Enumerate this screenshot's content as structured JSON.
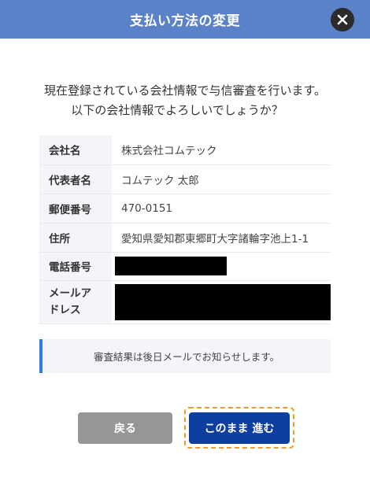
{
  "header": {
    "title": "支払い方法の変更",
    "close_icon": "close-icon"
  },
  "message": {
    "line1": "現在登録されている会社情報で与信審査を行います。",
    "line2": "以下の会社情報でよろしいでしょうか？"
  },
  "company_info": {
    "rows": [
      {
        "label": "会社名",
        "value": "株式会社コムテック"
      },
      {
        "label": "代表者名",
        "value": "コムテック 太郎"
      },
      {
        "label": "郵便番号",
        "value": "470-0151"
      },
      {
        "label": "住所",
        "value": "愛知県愛知郡東郷町大字諸輪字池上1-1"
      },
      {
        "label": "電話番号",
        "value": null,
        "redacted": true
      },
      {
        "label": "メールアドレス",
        "value": null,
        "redacted": true
      }
    ]
  },
  "notice": {
    "text": "審査結果は後日メールでお知らせします。",
    "accent_color": "#2f7de1"
  },
  "actions": {
    "back_label": "戻る",
    "proceed_label": "このまま 進む"
  },
  "colors": {
    "header_bg": "#5b82c9",
    "primary_button": "#0e3fa0",
    "secondary_button": "#969696",
    "focus_ring": "#f29a2e"
  }
}
